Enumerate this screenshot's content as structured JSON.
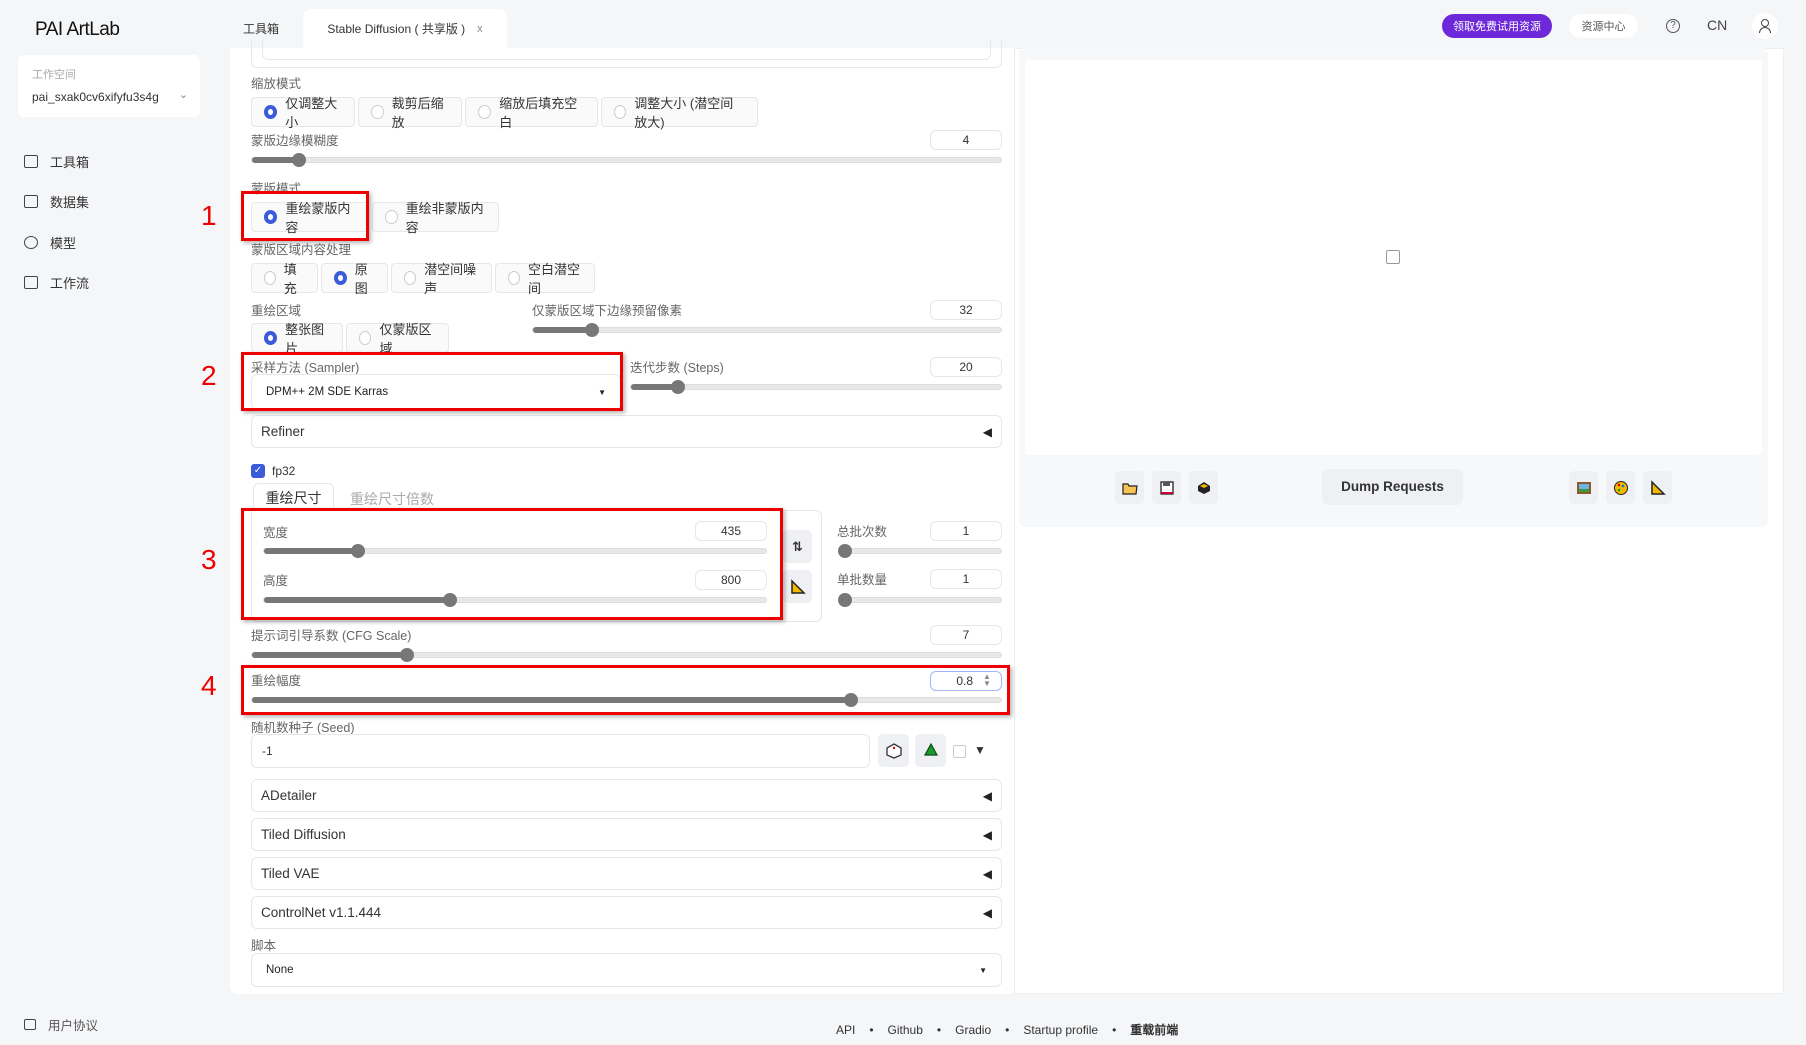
{
  "app": {
    "logo": "PAI ArtLab"
  },
  "workspace": {
    "label": "工作空间",
    "value": "pai_sxak0cv6xifyfu3s4g"
  },
  "sidebar": {
    "items": [
      {
        "label": "工具箱"
      },
      {
        "label": "数据集"
      },
      {
        "label": "模型"
      },
      {
        "label": "工作流"
      }
    ],
    "footer": "用户协议"
  },
  "tabs": [
    {
      "label": "工具箱"
    },
    {
      "label": "Stable Diffusion ( 共享版 )",
      "close": "x"
    }
  ],
  "header": {
    "promo": "领取免费试用资源",
    "resource": "资源中心",
    "lang": "CN"
  },
  "resize_mode": {
    "label": "缩放模式",
    "options": [
      "仅调整大小",
      "裁剪后缩放",
      "缩放后填充空白",
      "调整大小 (潜空间放大)"
    ],
    "selected": 0
  },
  "mask_blur": {
    "label": "蒙版边缘模糊度",
    "value": 4,
    "min": 0,
    "max": 64
  },
  "mask_mode": {
    "label": "蒙版模式",
    "options": [
      "重绘蒙版内容",
      "重绘非蒙版内容"
    ],
    "selected": 0
  },
  "masked_content": {
    "label": "蒙版区域内容处理",
    "options": [
      "填充",
      "原图",
      "潜空间噪声",
      "空白潜空间"
    ],
    "selected": 1
  },
  "inpaint_area": {
    "label": "重绘区域",
    "options": [
      "整张图片",
      "仅蒙版区域"
    ],
    "selected": 0
  },
  "padding": {
    "label": "仅蒙版区域下边缘预留像素",
    "value": 32,
    "min": 0,
    "max": 256
  },
  "sampler": {
    "label": "采样方法 (Sampler)",
    "value": "DPM++ 2M SDE Karras"
  },
  "steps": {
    "label": "迭代步数 (Steps)",
    "value": 20,
    "min": 1,
    "max": 150
  },
  "refiner": {
    "label": "Refiner"
  },
  "fp32": {
    "label": "fp32",
    "checked": true
  },
  "size_tabs": [
    "重绘尺寸",
    "重绘尺寸倍数"
  ],
  "width": {
    "label": "宽度",
    "value": 435,
    "min": 64,
    "max": 2048
  },
  "height": {
    "label": "高度",
    "value": 800,
    "min": 64,
    "max": 2048
  },
  "batch_count": {
    "label": "总批次数",
    "value": 1,
    "min": 1,
    "max": 100
  },
  "batch_size": {
    "label": "单批数量",
    "value": 1,
    "min": 1,
    "max": 8
  },
  "cfg": {
    "label": "提示词引导系数 (CFG Scale)",
    "value": 7,
    "min": 1,
    "max": 30
  },
  "denoise": {
    "label": "重绘幅度",
    "value": "0.8",
    "num": 0.8,
    "min": 0,
    "max": 1
  },
  "seed": {
    "label": "随机数种子 (Seed)",
    "value": "-1"
  },
  "accordions": [
    "ADetailer",
    "Tiled Diffusion",
    "Tiled VAE",
    "ControlNet v1.1.444"
  ],
  "script": {
    "label": "脚本",
    "value": "None"
  },
  "annotations": [
    "1",
    "2",
    "3",
    "4"
  ],
  "output": {
    "dump": "Dump Requests"
  },
  "footer": [
    "API",
    "Github",
    "Gradio",
    "Startup profile",
    "重载前端"
  ],
  "colors": {
    "accent": "#3b5bdb",
    "promo": "#6d28d9",
    "annotation": "#e00000"
  }
}
